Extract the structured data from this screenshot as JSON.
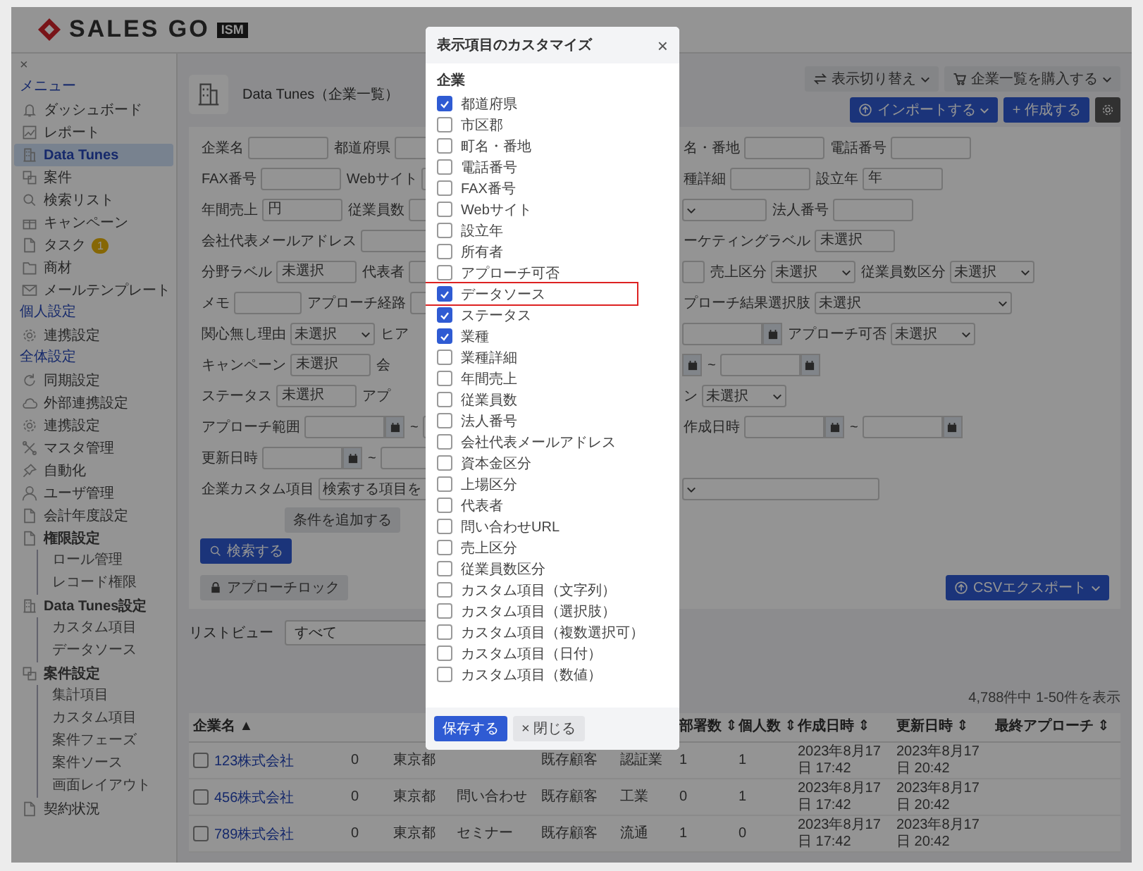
{
  "header": {
    "logo": "SALES GO",
    "badge": "ISM"
  },
  "sidebar": {
    "close": "×",
    "sections": [
      {
        "title": "メニュー",
        "items": [
          {
            "label": "ダッシュボード",
            "selected": false
          },
          {
            "label": "レポート",
            "selected": false
          },
          {
            "label": "Data Tunes",
            "selected": true
          },
          {
            "label": "案件",
            "selected": false
          },
          {
            "label": "検索リスト",
            "selected": false
          },
          {
            "label": "キャンペーン",
            "selected": false
          },
          {
            "label": "タスク",
            "selected": false,
            "badge": "1"
          },
          {
            "label": "商材",
            "selected": false
          },
          {
            "label": "メールテンプレート",
            "selected": false
          }
        ]
      },
      {
        "title": "個人設定",
        "items": [
          {
            "label": "連携設定",
            "selected": false
          }
        ]
      },
      {
        "title": "全体設定",
        "items": [
          {
            "label": "同期設定",
            "selected": false
          },
          {
            "label": "外部連携設定",
            "selected": false
          },
          {
            "label": "連携設定",
            "selected": false
          },
          {
            "label": "マスタ管理",
            "selected": false
          },
          {
            "label": "自動化",
            "selected": false
          },
          {
            "label": "ユーザ管理",
            "selected": false
          },
          {
            "label": "会計年度設定",
            "selected": false
          },
          {
            "label": "権限設定",
            "selected": false,
            "children": [
              {
                "label": "ロール管理",
                "selected": false
              },
              {
                "label": "レコード権限",
                "selected": false
              }
            ]
          },
          {
            "label": "Data Tunes設定",
            "selected": false,
            "children": [
              {
                "label": "カスタム項目",
                "selected": false
              },
              {
                "label": "データソース",
                "selected": false
              }
            ]
          },
          {
            "label": "案件設定",
            "selected": false,
            "children": [
              {
                "label": "集計項目",
                "selected": false
              },
              {
                "label": "カスタム項目",
                "selected": false
              },
              {
                "label": "案件フェーズ",
                "selected": false
              },
              {
                "label": "案件ソース",
                "selected": false
              },
              {
                "label": "画面レイアウト",
                "selected": false
              }
            ]
          },
          {
            "label": "契約状況",
            "selected": false
          }
        ]
      }
    ]
  },
  "page": {
    "title": "Data Tunes（企業一覧）",
    "actions": [
      {
        "kind": "toggle",
        "label": "表示切り替え",
        "dropdown": true
      },
      {
        "kind": "cart",
        "label": "企業一覧を購入する",
        "dropdown": true
      },
      {
        "kind": "import",
        "label": "インポートする",
        "dropdown": true
      },
      {
        "kind": "create",
        "label": "+ 作成する",
        "dropdown": false
      },
      {
        "kind": "settings",
        "dropdown": false
      }
    ]
  },
  "filters": {
    "rows": [
      {
        "left": [
          {
            "kind": "label",
            "text": "企業名"
          },
          {
            "kind": "input"
          },
          {
            "kind": "label",
            "text": "都道府県"
          },
          {
            "kind": "input"
          }
        ],
        "right": [
          {
            "kind": "label",
            "text": "名・番地"
          },
          {
            "kind": "input"
          },
          {
            "kind": "label",
            "text": "電話番号"
          },
          {
            "kind": "input"
          }
        ]
      },
      {
        "left": [
          {
            "kind": "label",
            "text": "FAX番号"
          },
          {
            "kind": "input"
          },
          {
            "kind": "label",
            "text": "Webサイト"
          },
          {
            "kind": "input"
          }
        ],
        "right": [
          {
            "kind": "label",
            "text": "種詳細"
          },
          {
            "kind": "input"
          },
          {
            "kind": "label",
            "text": "設立年"
          },
          {
            "kind": "input",
            "value": "年"
          }
        ]
      },
      {
        "left": [
          {
            "kind": "label",
            "text": "年間売上"
          },
          {
            "kind": "input",
            "value": "円"
          },
          {
            "kind": "label",
            "text": "従業員数"
          },
          {
            "kind": "input"
          }
        ],
        "right": [
          {
            "kind": "select"
          },
          {
            "kind": "label",
            "text": "法人番号"
          },
          {
            "kind": "input"
          }
        ]
      },
      {
        "left": [
          {
            "kind": "label",
            "text": "会社代表メールアドレス"
          },
          {
            "kind": "input"
          }
        ],
        "right": [
          {
            "kind": "label",
            "text": "ーケティングラベル"
          },
          {
            "kind": "input",
            "value": "未選択"
          }
        ]
      },
      {
        "left": [
          {
            "kind": "label",
            "text": "分野ラベル"
          },
          {
            "kind": "input",
            "value": "未選択"
          },
          {
            "kind": "label",
            "text": "代表者"
          },
          {
            "kind": "input"
          }
        ],
        "right": [
          {
            "kind": "tiny"
          },
          {
            "kind": "label",
            "text": "売上区分"
          },
          {
            "kind": "select",
            "value": "未選択"
          },
          {
            "kind": "label",
            "text": "従業員数区分"
          },
          {
            "kind": "select",
            "value": "未選択"
          }
        ]
      },
      {
        "left": [
          {
            "kind": "label",
            "text": "メモ"
          },
          {
            "kind": "short"
          },
          {
            "kind": "label",
            "text": "アプローチ経路"
          },
          {
            "kind": "input"
          }
        ],
        "right": [
          {
            "kind": "label",
            "text": "プローチ結果選択肢"
          },
          {
            "kind": "wideselect",
            "value": "未選択"
          }
        ]
      },
      {
        "left": [
          {
            "kind": "label",
            "text": "関心無し理由"
          },
          {
            "kind": "select",
            "value": "未選択"
          },
          {
            "kind": "label",
            "text": "ヒア"
          }
        ],
        "right": [
          {
            "kind": "date"
          },
          {
            "kind": "label",
            "text": "アプローチ可否"
          },
          {
            "kind": "select",
            "value": "未選択"
          }
        ]
      },
      {
        "left": [
          {
            "kind": "label",
            "text": "キャンペーン"
          },
          {
            "kind": "input",
            "value": "未選択"
          },
          {
            "kind": "label",
            "text": "会"
          }
        ],
        "right": [
          {
            "kind": "calendar"
          },
          {
            "kind": "label",
            "text": "~"
          },
          {
            "kind": "date"
          }
        ]
      },
      {
        "left": [
          {
            "kind": "label",
            "text": "ステータス"
          },
          {
            "kind": "input",
            "value": "未選択"
          },
          {
            "kind": "label",
            "text": "アプ"
          }
        ],
        "right": [
          {
            "kind": "label",
            "text": "ン"
          },
          {
            "kind": "select",
            "value": "未選択"
          }
        ]
      },
      {
        "left": [
          {
            "kind": "label",
            "text": "アプローチ範囲"
          },
          {
            "kind": "date"
          },
          {
            "kind": "label",
            "text": "~"
          },
          {
            "kind": "input"
          }
        ],
        "right": [
          {
            "kind": "label",
            "text": "作成日時"
          },
          {
            "kind": "date"
          },
          {
            "kind": "label",
            "text": "~"
          },
          {
            "kind": "date"
          }
        ]
      },
      {
        "left": [
          {
            "kind": "label",
            "text": "更新日時"
          },
          {
            "kind": "date"
          },
          {
            "kind": "label",
            "text": "~"
          },
          {
            "kind": "input"
          }
        ]
      },
      {
        "left": [
          {
            "kind": "label",
            "text": "企業カスタム項目"
          },
          {
            "kind": "wideselect",
            "value": "検索する項目を"
          }
        ],
        "right": [
          {
            "kind": "wideselect"
          }
        ]
      }
    ],
    "add_condition": "条件を追加する",
    "search": "検索する",
    "lock": "アプローチロック",
    "export": "CSVエクスポート"
  },
  "list": {
    "view_label": "リストビュー",
    "view_value": "すべて",
    "count": "4,788件中 1-50件を表示"
  },
  "table": {
    "columns": [
      {
        "label": "企業名 ▲"
      },
      {},
      {},
      {},
      {},
      {},
      {
        "label": "部署数 ⇕"
      },
      {
        "label": "個人数 ⇕"
      },
      {
        "label": "作成日時 ⇕"
      },
      {
        "label": "更新日時 ⇕"
      },
      {
        "label": "最終アプローチ ⇕"
      }
    ],
    "rows": [
      {
        "selected": false,
        "cells": [
          "123株式会社",
          "0",
          "東京都",
          null,
          "既存顧客",
          "認証業",
          "1",
          "1",
          "2023年8月17日 17:42",
          "2023年8月17日 20:42",
          null
        ]
      },
      {
        "selected": false,
        "cells": [
          "456株式会社",
          "0",
          "東京都",
          "問い合わせ",
          "既存顧客",
          "工業",
          "0",
          "1",
          "2023年8月17日 17:42",
          "2023年8月17日 20:42",
          null
        ]
      },
      {
        "selected": false,
        "cells": [
          "789株式会社",
          "0",
          "東京都",
          "セミナー",
          "既存顧客",
          "流通",
          "1",
          "0",
          "2023年8月17日 17:42",
          "2023年8月17日 20:42",
          null
        ]
      }
    ]
  },
  "modal": {
    "title": "表示項目のカスタマイズ",
    "close": "×",
    "section": "企業",
    "options": [
      {
        "label": "都道府県",
        "checked": true,
        "highlighted": false
      },
      {
        "label": "市区郡",
        "checked": false,
        "highlighted": false
      },
      {
        "label": "町名・番地",
        "checked": false,
        "highlighted": false
      },
      {
        "label": "電話番号",
        "checked": false,
        "highlighted": false
      },
      {
        "label": "FAX番号",
        "checked": false,
        "highlighted": false
      },
      {
        "label": "Webサイト",
        "checked": false,
        "highlighted": false
      },
      {
        "label": "設立年",
        "checked": false,
        "highlighted": false
      },
      {
        "label": "所有者",
        "checked": false,
        "highlighted": false
      },
      {
        "label": "アプローチ可否",
        "checked": false,
        "highlighted": false
      },
      {
        "label": "データソース",
        "checked": true,
        "highlighted": true
      },
      {
        "label": "ステータス",
        "checked": true,
        "highlighted": false
      },
      {
        "label": "業種",
        "checked": true,
        "highlighted": false
      },
      {
        "label": "業種詳細",
        "checked": false,
        "highlighted": false
      },
      {
        "label": "年間売上",
        "checked": false,
        "highlighted": false
      },
      {
        "label": "従業員数",
        "checked": false,
        "highlighted": false
      },
      {
        "label": "法人番号",
        "checked": false,
        "highlighted": false
      },
      {
        "label": "会社代表メールアドレス",
        "checked": false,
        "highlighted": false
      },
      {
        "label": "資本金区分",
        "checked": false,
        "highlighted": false
      },
      {
        "label": "上場区分",
        "checked": false,
        "highlighted": false
      },
      {
        "label": "代表者",
        "checked": false,
        "highlighted": false
      },
      {
        "label": "問い合わせURL",
        "checked": false,
        "highlighted": false
      },
      {
        "label": "売上区分",
        "checked": false,
        "highlighted": false
      },
      {
        "label": "従業員数区分",
        "checked": false,
        "highlighted": false
      },
      {
        "label": "カスタム項目（文字列）",
        "checked": false,
        "highlighted": false
      },
      {
        "label": "カスタム項目（選択肢）",
        "checked": false,
        "highlighted": false
      },
      {
        "label": "カスタム項目（複数選択可）",
        "checked": false,
        "highlighted": false
      },
      {
        "label": "カスタム項目（日付）",
        "checked": false,
        "highlighted": false
      },
      {
        "label": "カスタム項目（数値）",
        "checked": false,
        "highlighted": false
      }
    ],
    "save": "保存する",
    "cancel": "× 閉じる"
  }
}
